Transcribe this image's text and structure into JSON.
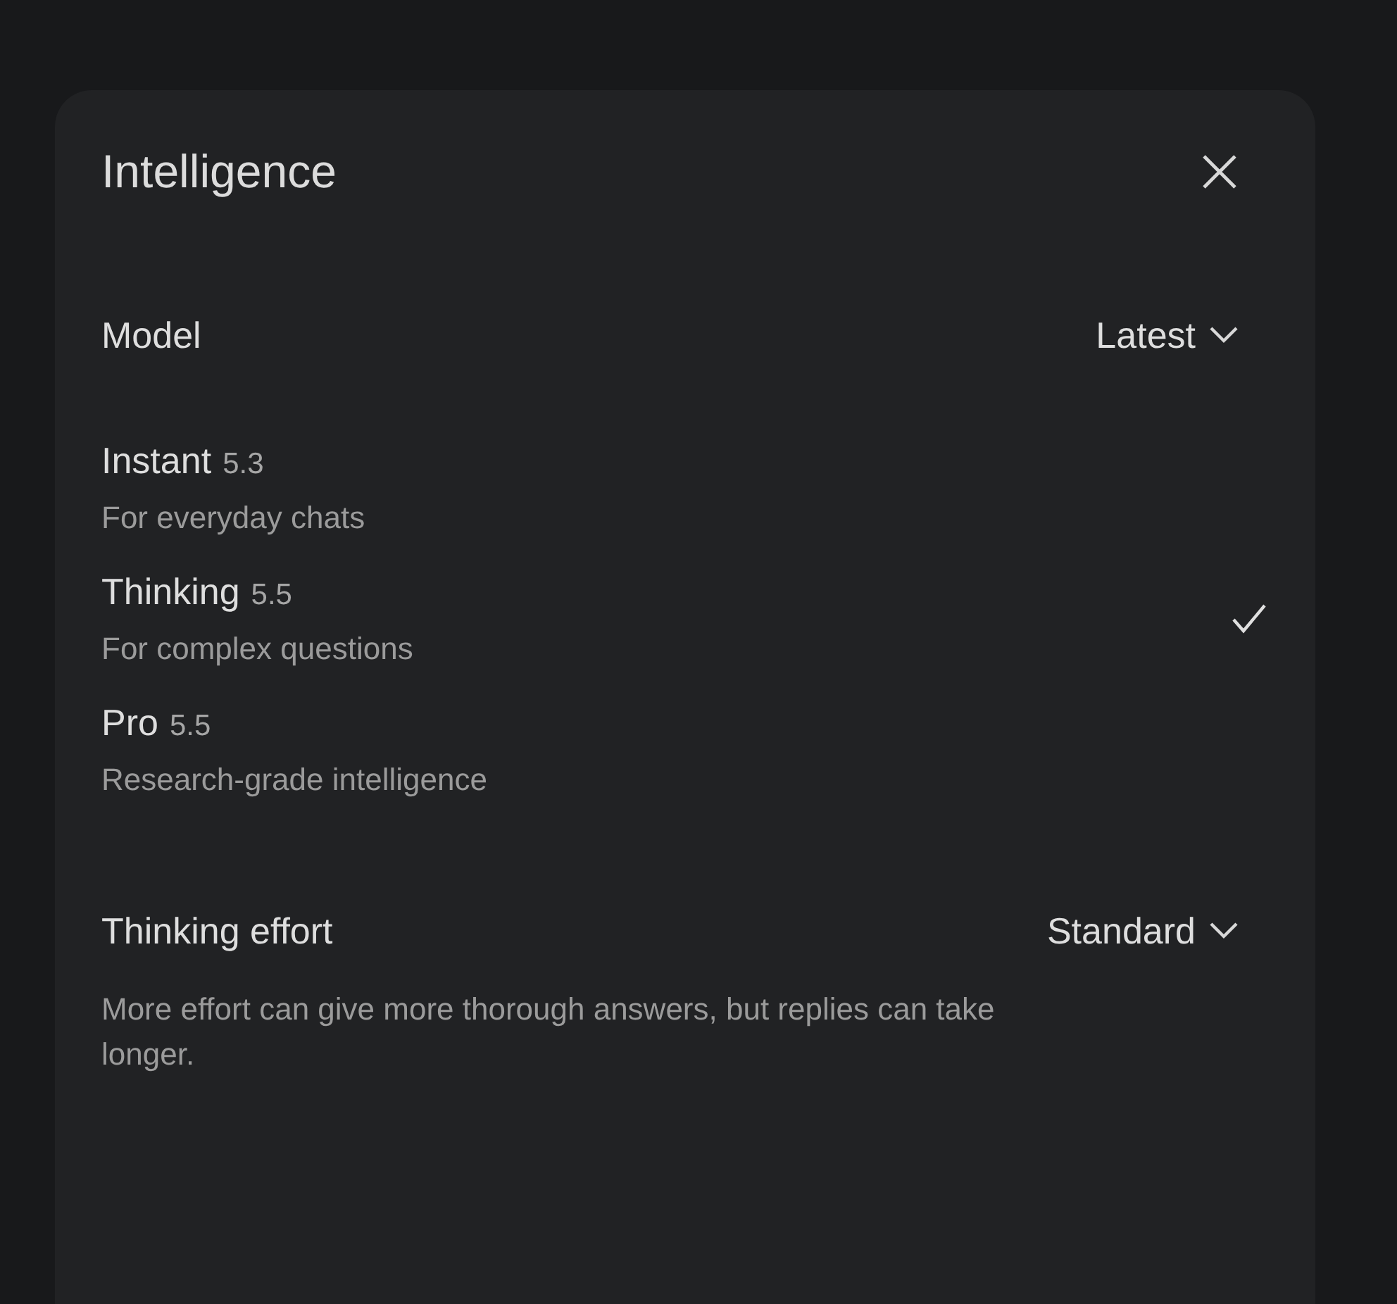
{
  "dialog": {
    "title": "Intelligence"
  },
  "model": {
    "label": "Model",
    "value": "Latest"
  },
  "options": [
    {
      "name": "Instant",
      "version": "5.3",
      "description": "For everyday chats",
      "selected": false
    },
    {
      "name": "Thinking",
      "version": "5.5",
      "description": "For complex questions",
      "selected": true
    },
    {
      "name": "Pro",
      "version": "5.5",
      "description": "Research-grade intelligence",
      "selected": false
    }
  ],
  "effort": {
    "label": "Thinking effort",
    "value": "Standard",
    "description": "More effort can give more thorough answers, but replies can take longer."
  }
}
